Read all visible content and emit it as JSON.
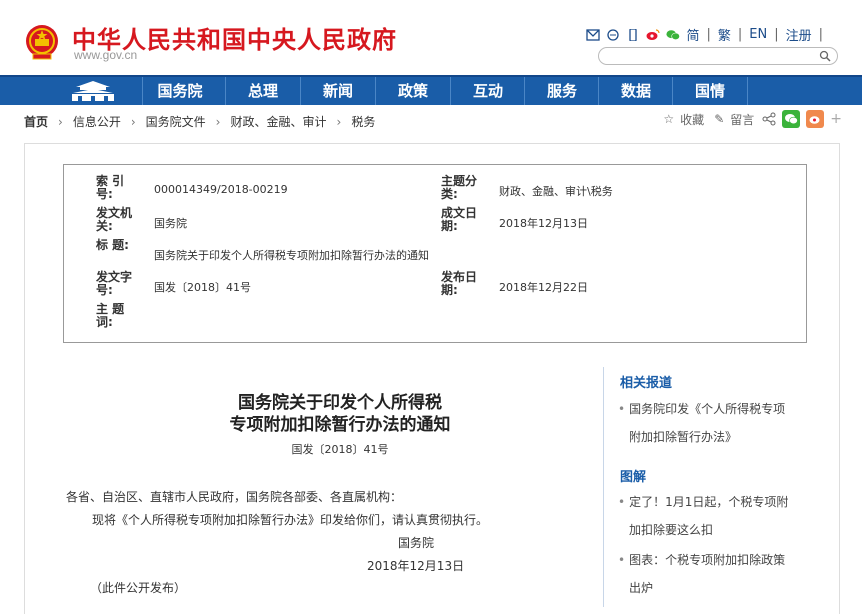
{
  "header": {
    "title": "中华人民共和国中央人民政府",
    "url": "www.gov.cn",
    "links": [
      "简",
      "繁",
      "EN",
      "注册"
    ]
  },
  "nav": [
    "国务院",
    "总理",
    "新闻",
    "政策",
    "互动",
    "服务",
    "数据",
    "国情"
  ],
  "breadcrumb": [
    "首页",
    "信息公开",
    "国务院文件",
    "财政、金融、审计",
    "税务"
  ],
  "tools": {
    "collect": "收藏",
    "print": "留言"
  },
  "info": {
    "index_label": "索 引 号:",
    "index_value": "000014349/2018-00219",
    "topic_label": "主题分类:",
    "topic_value": "财政、金融、审计\\税务",
    "issuer_label": "发文机关:",
    "issuer_value": "国务院",
    "date_label": "成文日期:",
    "date_value": "2018年12月13日",
    "title_label": "标 题:",
    "title_value": "国务院关于印发个人所得税专项附加扣除暂行办法的通知",
    "docno_label": "发文字号:",
    "docno_value": "国发〔2018〕41号",
    "pub_label": "发布日期:",
    "pub_value": "2018年12月22日",
    "keywords_label": "主 题 词:"
  },
  "document": {
    "title_line1": "国务院关于印发个人所得税",
    "title_line2": "专项附加扣除暂行办法的通知",
    "number": "国发〔2018〕41号",
    "salutation": "各省、自治区、直辖市人民政府，国务院各部委、各直属机构：",
    "para1": "现将《个人所得税专项附加扣除暂行办法》印发给你们，请认真贯彻执行。",
    "signer": "国务院",
    "date": "2018年12月13日",
    "note": "（此件公开发布）"
  },
  "sidebar": {
    "related_head": "相关报道",
    "related_line1": "国务院印发《个人所得税专项",
    "related_line2": "附加扣除暂行办法》",
    "graphic_head": "图解",
    "g1_line1": "定了！1月1日起，个税专项附",
    "g1_line2": "加扣除要这么扣",
    "g2_line1": "图表：个税专项附加扣除政策",
    "g2_line2": "出炉"
  }
}
